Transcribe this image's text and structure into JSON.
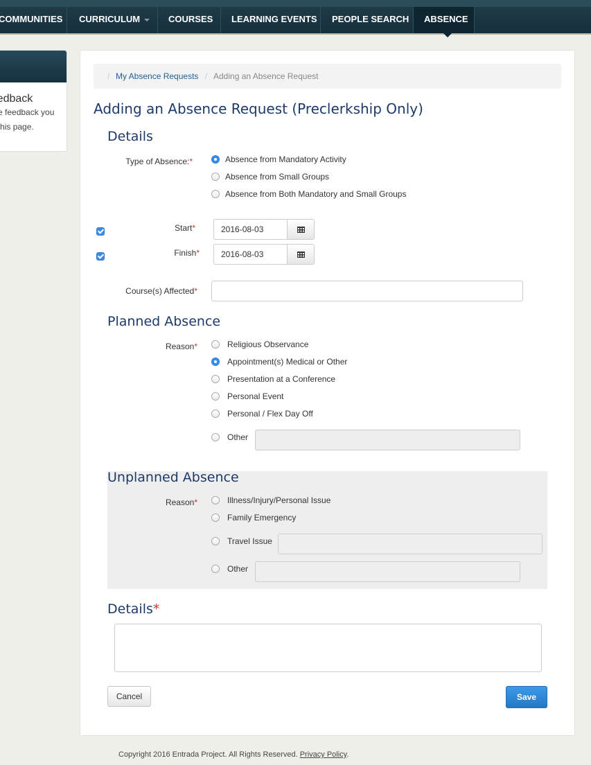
{
  "nav": {
    "items": [
      "COMMUNITIES",
      "CURRICULUM",
      "COURSES",
      "LEARNING EVENTS",
      "PEOPLE SEARCH",
      "ABSENCE"
    ],
    "active": "ABSENCE"
  },
  "sidebar": {
    "title": "Feedback",
    "line1": "Give feedback you",
    "line2": "on this page."
  },
  "breadcrumb": {
    "link": "My Absence Requests",
    "current": "Adding an Absence Request",
    "separator": "/"
  },
  "page_title": "Adding an Absence Request (Preclerkship Only)",
  "details": {
    "heading": "Details",
    "type_label": "Type of Absence:",
    "type_options": [
      "Absence from Mandatory Activity",
      "Absence from Small Groups",
      "Absence from Both Mandatory and Small Groups"
    ],
    "type_selected": "Absence from Mandatory Activity",
    "start_label": "Start",
    "start_value": "2016-08-03",
    "start_checked": true,
    "finish_label": "Finish",
    "finish_value": "2016-08-03",
    "finish_checked": true,
    "courses_label": "Course(s) Affected",
    "courses_value": ""
  },
  "planned": {
    "heading": "Planned Absence",
    "reason_label": "Reason",
    "options": [
      "Religious Observance",
      "Appointment(s) Medical or Other",
      "Presentation at a Conference",
      "Personal Event",
      "Personal / Flex Day Off",
      "Other"
    ],
    "selected": "Appointment(s) Medical or Other",
    "other_value": ""
  },
  "unplanned": {
    "heading": "Unplanned Absence",
    "reason_label": "Reason",
    "options": [
      "Illness/Injury/Personal Issue",
      "Family Emergency",
      "Travel Issue",
      "Other"
    ],
    "selected": null,
    "travel_value": "",
    "other_value": ""
  },
  "details_text": {
    "heading": "Details",
    "value": ""
  },
  "buttons": {
    "cancel": "Cancel",
    "save": "Save"
  },
  "required_marker": "*",
  "footer": {
    "text": "Copyright 2016 Entrada Project. All Rights Reserved.",
    "link": "Privacy Policy",
    "tail": "."
  },
  "colors": {
    "nav_bg": "#1f3b47",
    "accent_blue": "#2478c6",
    "heading_blue": "#1d3a6b",
    "required_red": "#c0392b"
  },
  "icons": {
    "calendar": "calendar-icon",
    "dropdown_caret": "chevron-down-icon"
  }
}
